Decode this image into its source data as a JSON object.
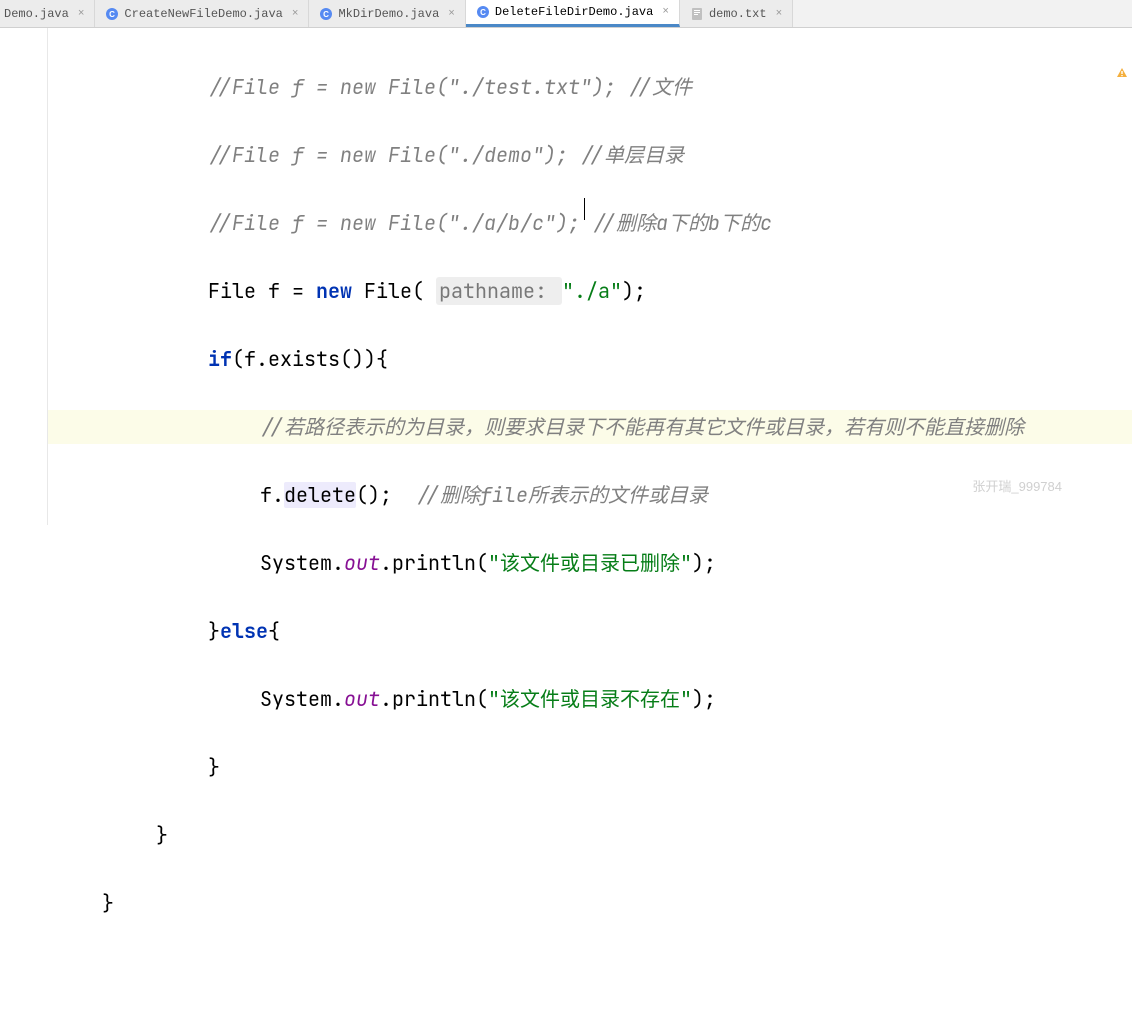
{
  "tabs": [
    {
      "label": "Demo.java",
      "type": "java"
    },
    {
      "label": "CreateNewFileDemo.java",
      "type": "java"
    },
    {
      "label": "MkDirDemo.java",
      "type": "java"
    },
    {
      "label": "DeleteFileDirDemo.java",
      "type": "java"
    },
    {
      "label": "demo.txt",
      "type": "text"
    }
  ],
  "code": {
    "l1_comment": "//File f = new File(\"./test.txt\"); //文件",
    "l2_comment": "//File f = new File(\"./demo\"); //单层目录",
    "l3_comment": "//File f = new File(\"./a/b/c\"); //删除a下的b下的c",
    "l4_type": "File",
    "l4_var": " f = ",
    "l4_new": "new",
    "l4_ctor": " File( ",
    "l4_hint": "pathname: ",
    "l4_str": "\"./a\"",
    "l4_end": ");",
    "l5_if": "if",
    "l5_cond": "(f.exists()){",
    "l6_comment": "//若路径表示的为目录，则要求目录下不能再有其它文件或目录，若有则不能直接删除",
    "l7_pre": "f.",
    "l7_del": "delete",
    "l7_post": "();  ",
    "l7_cmt": "//删除file所表示的文件或目录",
    "l8_sys": "System.",
    "l8_out": "out",
    "l8_print": ".println(",
    "l8_str": "\"该文件或目录已删除\"",
    "l8_end": ");",
    "l9_close": "}",
    "l9_else": "else",
    "l9_open": "{",
    "l10_sys": "System.",
    "l10_out": "out",
    "l10_print": ".println(",
    "l10_str": "\"该文件或目录不存在\"",
    "l10_end": ");",
    "l11": "}",
    "l12": "}",
    "l13": "}"
  },
  "watermark": "张开瑞_999784"
}
